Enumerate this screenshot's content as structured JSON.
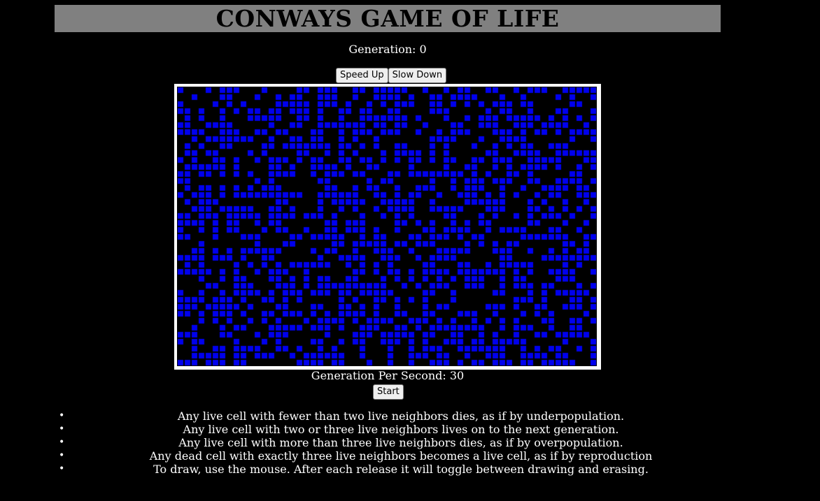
{
  "header": {
    "title": "CONWAYS GAME OF LIFE"
  },
  "status": {
    "generation_label": "Generation: 0",
    "gps_label": "Generation Per Second: 30"
  },
  "controls": {
    "speed_up_label": "Speed Up",
    "slow_down_label": "Slow Down",
    "start_label": "Start"
  },
  "board": {
    "live_color": "#0000ee",
    "dead_color": "#000000",
    "grid_line_color": "#000000",
    "frame_color": "#ffffff",
    "cols": 60,
    "rows": 40,
    "seed": 7
  },
  "rules": [
    "Any live cell with fewer than two live neighbors dies, as if by underpopulation.",
    "Any live cell with two or three live neighbors lives on to the next generation.",
    "Any live cell with more than three live neighbors dies, as if by overpopulation.",
    "Any dead cell with exactly three live neighbors becomes a live cell, as if by reproduction",
    "To draw, use the mouse. After each release it will toggle between drawing and erasing."
  ]
}
